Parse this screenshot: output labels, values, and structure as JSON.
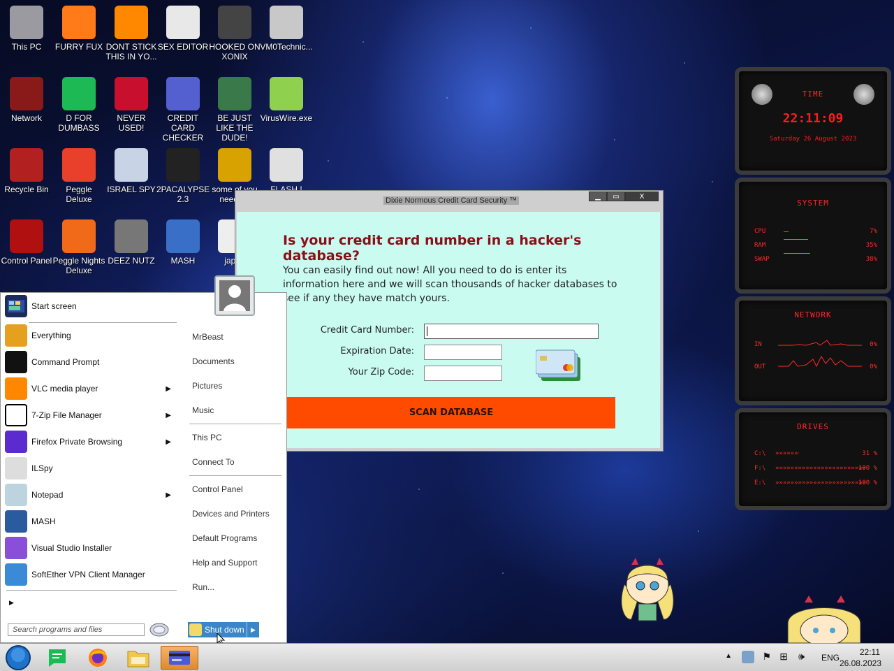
{
  "desktop_icons": [
    {
      "label": "This PC",
      "icon": "this-pc-icon"
    },
    {
      "label": "FURRY FUX",
      "icon": "firefox-icon"
    },
    {
      "label": "DONT STICK THIS IN YO...",
      "icon": "vlc-cone-icon"
    },
    {
      "label": "SEX EDITOR",
      "icon": "hxd-icon"
    },
    {
      "label": "HOOKED ON XONIX",
      "icon": "game-icon"
    },
    {
      "label": "VM0Technic...",
      "icon": "doctor-icon"
    },
    {
      "label": "Network",
      "icon": "network-icon"
    },
    {
      "label": "D FOR DUMBASS",
      "icon": "green-d-icon"
    },
    {
      "label": "NEVER USED!",
      "icon": "devcpp-icon"
    },
    {
      "label": "CREDIT CARD CHECKER",
      "icon": "credit-card-icon"
    },
    {
      "label": "BE JUST LIKE THE DUDE!",
      "icon": "dude-icon"
    },
    {
      "label": "VirusWire.exe",
      "icon": "lime-icon"
    },
    {
      "label": "Recycle Bin",
      "icon": "recycle-bin-icon"
    },
    {
      "label": "Peggle Deluxe",
      "icon": "peggle-icon"
    },
    {
      "label": "ISRAEL SPY",
      "icon": "spy-icon"
    },
    {
      "label": "2PACALYPSE 2.3",
      "icon": "terminal-icon"
    },
    {
      "label": "some of you need t...",
      "icon": "beaver-icon"
    },
    {
      "label": "FLASH !",
      "icon": "flash-icon"
    },
    {
      "label": "Control Panel",
      "icon": "control-panel-icon"
    },
    {
      "label": "Peggle Nights Deluxe",
      "icon": "peggle-nights-icon"
    },
    {
      "label": "DEEZ NUTZ",
      "icon": "stack-icon"
    },
    {
      "label": "MASH",
      "icon": "mash-icon"
    },
    {
      "label": "japan",
      "icon": "japan-icon"
    }
  ],
  "dialog": {
    "title": "Dixie Normous Credit Card Security ™",
    "heading": "Is your credit card number in a hacker's database?",
    "body": "You can easily find out now! All you need to do is enter its information here and we will scan thousands of hacker databases to see if any they have match yours.",
    "card_number_label": "Credit Card Number:",
    "expiration_label": "Expiration Date:",
    "zip_label": "Your Zip Code:",
    "scan_button": "SCAN DATABASE",
    "minimize": "▁",
    "maximize": "▭",
    "close": "X"
  },
  "start_menu": {
    "start_screen": "Start screen",
    "programs": [
      {
        "label": "Everything",
        "icon": "everything-icon",
        "has_arrow": false
      },
      {
        "label": "Command Prompt",
        "icon": "cmd-icon",
        "has_arrow": false
      },
      {
        "label": "VLC media player",
        "icon": "vlc-icon",
        "has_arrow": true
      },
      {
        "label": "7-Zip File Manager",
        "icon": "7zip-icon",
        "has_arrow": true
      },
      {
        "label": "Firefox Private Browsing",
        "icon": "firefox-private-icon",
        "has_arrow": true
      },
      {
        "label": "ILSpy",
        "icon": "ilspy-icon",
        "has_arrow": false
      },
      {
        "label": "Notepad",
        "icon": "notepad-icon",
        "has_arrow": true
      },
      {
        "label": "MASH",
        "icon": "mash-icon",
        "has_arrow": false
      },
      {
        "label": "Visual Studio Installer",
        "icon": "vs-installer-icon",
        "has_arrow": false
      },
      {
        "label": "SoftEther VPN Client Manager",
        "icon": "softether-icon",
        "has_arrow": false
      }
    ],
    "right_links": [
      "MrBeast",
      "Documents",
      "Pictures",
      "Music",
      "This PC",
      "Connect To",
      "Control Panel",
      "Devices and Printers",
      "Default Programs",
      "Help and Support",
      "Run..."
    ],
    "search_placeholder": "Search programs and files",
    "shutdown": "Shut down"
  },
  "widgets": {
    "time_title": "TIME",
    "time": "22:11:09",
    "date": "Saturday 26 August 2023",
    "system_title": "SYSTEM",
    "cpu_label": "CPU",
    "cpu_value": "7%",
    "cpu_fraction": 0.07,
    "ram_label": "RAM",
    "ram_value": "35%",
    "ram_fraction": 0.35,
    "swap_label": "SWAP",
    "swap_value": "38%",
    "swap_fraction": 0.38,
    "network_title": "NETWORK",
    "in_label": "IN",
    "in_value": "0%",
    "out_label": "OUT",
    "out_value": "0%",
    "drives_title": "DRIVES",
    "drives": [
      {
        "label": "C:\\",
        "value": "31 %",
        "fraction": 0.31
      },
      {
        "label": "F:\\",
        "value": "100 %",
        "fraction": 1.0
      },
      {
        "label": "E:\\",
        "value": "100 %",
        "fraction": 1.0
      }
    ]
  },
  "taskbar": {
    "language": "ENG",
    "time": "22:11",
    "date": "26.08.2023"
  },
  "colors": {
    "dialog_bg": "#c9fbf1",
    "heading": "#8b0f17",
    "scan_button": "#ff4b00",
    "widget_red": "#ff2a2a",
    "shutdown_blue": "#3a86c8"
  }
}
